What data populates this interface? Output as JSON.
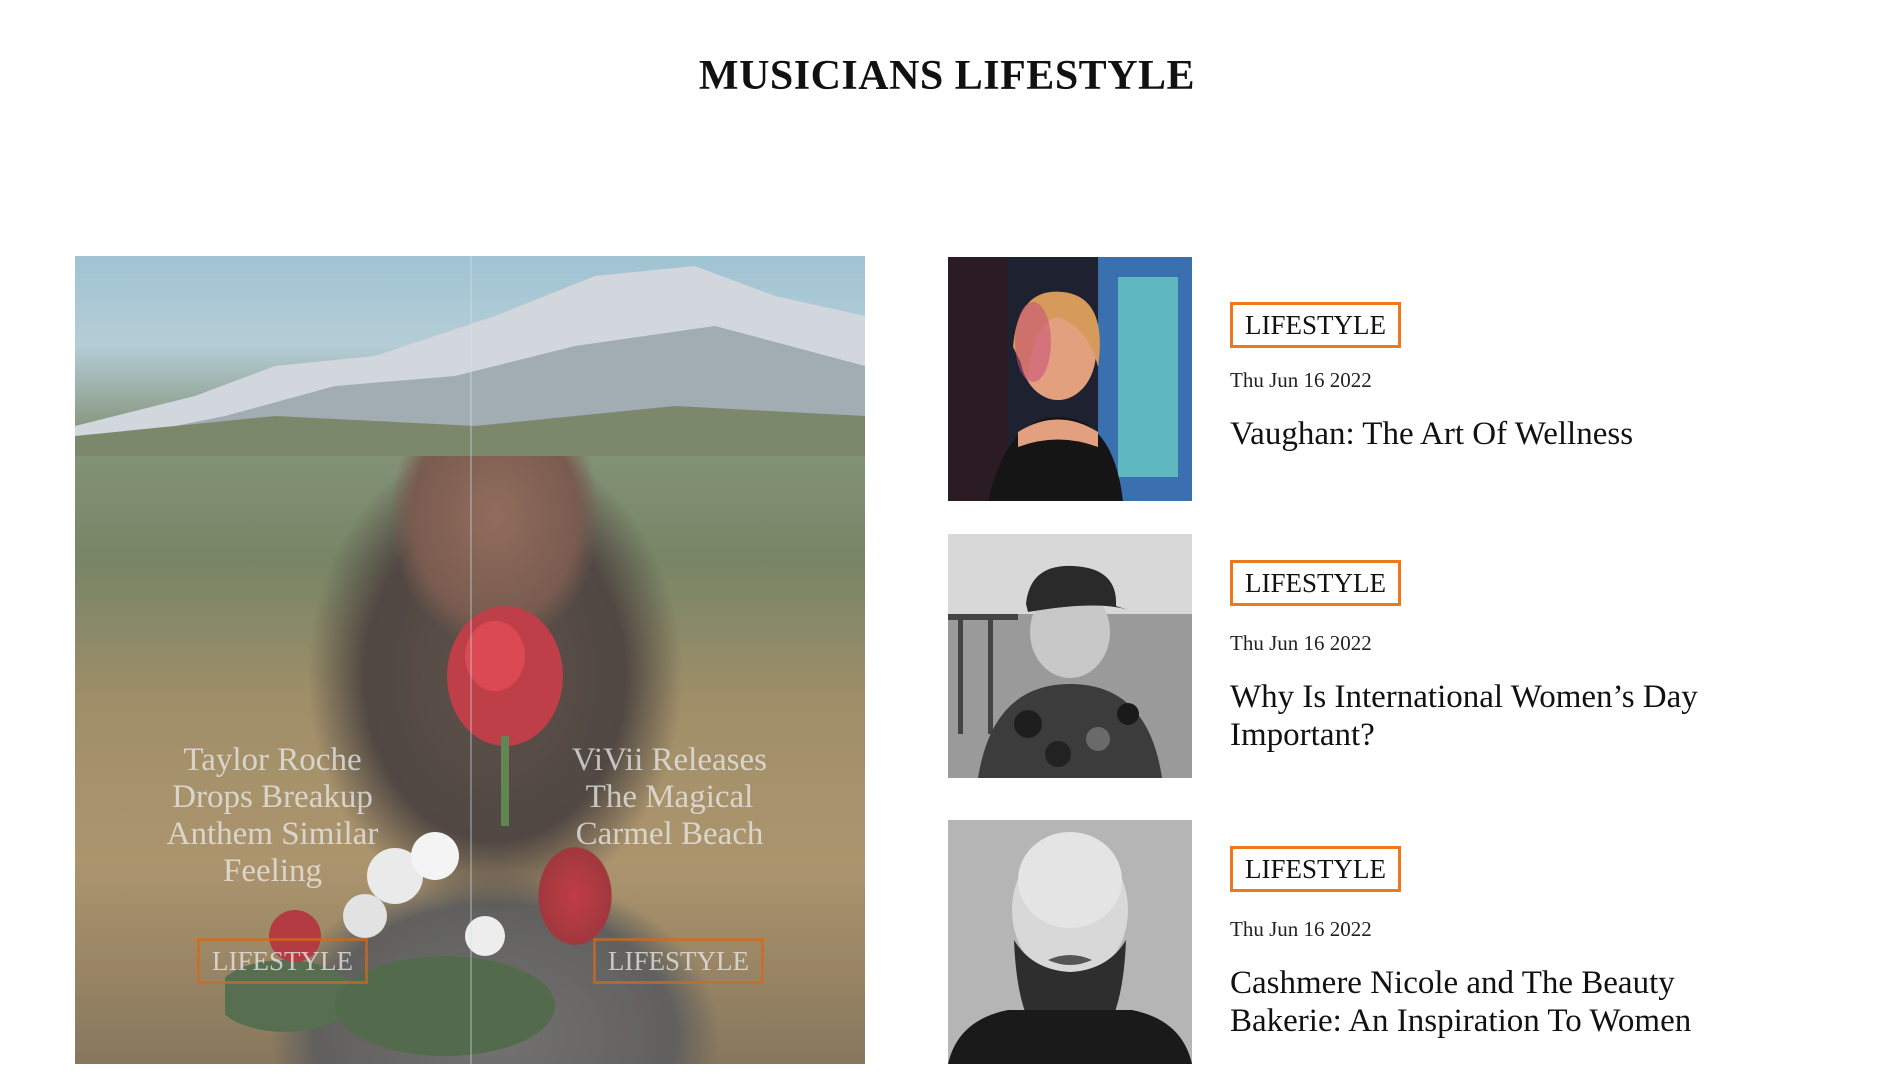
{
  "section": {
    "title": "MUSICIANS LIFESTYLE"
  },
  "featured": [
    {
      "title": "Taylor Roche Drops Breakup Anthem Similar Feeling",
      "category": "LIFESTYLE"
    },
    {
      "title": "ViVii Releases The Magical Carmel Beach",
      "category": "LIFESTYLE"
    }
  ],
  "articles": [
    {
      "category": "LIFESTYLE",
      "date": "Thu Jun 16 2022",
      "title": "Vaughan: The Art Of Wellness"
    },
    {
      "category": "LIFESTYLE",
      "date": "Thu Jun 16 2022",
      "title": "Why Is International Women’s Day Important?"
    },
    {
      "category": "LIFESTYLE",
      "date": "Thu Jun 16 2022",
      "title": "Cashmere Nicole and The Beauty Bakerie: An Inspiration To Women"
    }
  ],
  "colors": {
    "badge_border": "#ec7a1c"
  }
}
